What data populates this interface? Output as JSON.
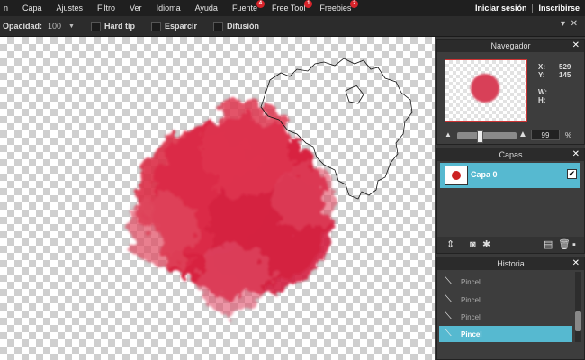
{
  "menubar": {
    "items": [
      {
        "label": "n",
        "badge": ""
      },
      {
        "label": "Capa",
        "badge": ""
      },
      {
        "label": "Ajustes",
        "badge": ""
      },
      {
        "label": "Filtro",
        "badge": ""
      },
      {
        "label": "Ver",
        "badge": ""
      },
      {
        "label": "Idioma",
        "badge": ""
      },
      {
        "label": "Ayuda",
        "badge": ""
      },
      {
        "label": "Fuente",
        "badge": "4"
      },
      {
        "label": "Free Tool",
        "badge": "1"
      },
      {
        "label": "Freebies",
        "badge": "2"
      }
    ],
    "login": "Iniciar sesión",
    "signup": "Inscribirse"
  },
  "toolbar": {
    "opacity_label": "Opacidad:",
    "opacity_value": "100",
    "options": [
      {
        "label": "Hard tip",
        "checked": false
      },
      {
        "label": "Esparcir",
        "checked": false
      },
      {
        "label": "Difusión",
        "checked": false
      }
    ],
    "right_icons": [
      "chevron-down-icon",
      "close-icon"
    ]
  },
  "brush_color": "#d8243f",
  "navigator": {
    "title": "Navegador",
    "x_label": "X:",
    "x_value": "529",
    "y_label": "Y:",
    "y_value": "145",
    "w_label": "W:",
    "w_value": "",
    "h_label": "H:",
    "h_value": "",
    "zoom_value": "99",
    "zoom_unit": "%"
  },
  "layers": {
    "title": "Capas",
    "items": [
      {
        "name": "Capa 0",
        "visible": true
      }
    ]
  },
  "history": {
    "title": "Historia",
    "items": [
      {
        "label": "Pincel"
      },
      {
        "label": "Pincel"
      },
      {
        "label": "Pincel"
      },
      {
        "label": "Pincel"
      }
    ],
    "selected_index": 3
  },
  "colors": {
    "accent": "#56b9d0",
    "badge": "#d8242b",
    "menubar_bg": "#1f1f1f"
  }
}
